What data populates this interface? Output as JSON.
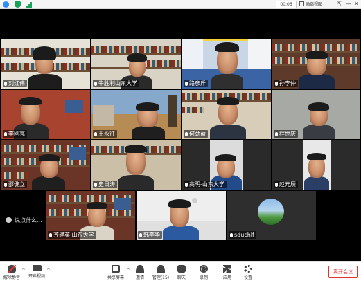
{
  "topbar": {
    "timer": "00:06",
    "view_label": "画廊视图",
    "win_controls": [
      "⇱",
      "—",
      "✕"
    ]
  },
  "participants": [
    {
      "name": "刘红伟",
      "muted": true
    },
    {
      "name": "牛胜利山东大学",
      "muted": true
    },
    {
      "name": "路彦斤",
      "muted": true
    },
    {
      "name": "孙李仲",
      "muted": true
    },
    {
      "name": "李刚亮",
      "muted": true
    },
    {
      "name": "王永征",
      "muted": true
    },
    {
      "name": "何劲盈",
      "muted": true
    },
    {
      "name": "程世庆",
      "muted": true
    },
    {
      "name": "邵健立",
      "muted": true
    },
    {
      "name": "史日涛",
      "muted": true
    },
    {
      "name": "高明-山东大学",
      "muted": true
    },
    {
      "name": "赵元辰",
      "muted": true
    },
    {
      "name": "齐建英 山东大学",
      "muted": true
    },
    {
      "name": "韩李华",
      "muted": true
    },
    {
      "name": "sduchlf",
      "muted": true
    }
  ],
  "chat_hint": "说点什么...",
  "toolbar": {
    "mute": "解除静音",
    "video": "开启视频",
    "share": "共享屏幕",
    "participants": "邀请",
    "participants_manage": "管理(15)",
    "chat": "聊天",
    "record": "录制",
    "apps": "应用",
    "settings": "设置",
    "leave": "离开会议"
  },
  "colors": {
    "active_speaker": "#f5d43b",
    "leave": "#e0342d"
  }
}
